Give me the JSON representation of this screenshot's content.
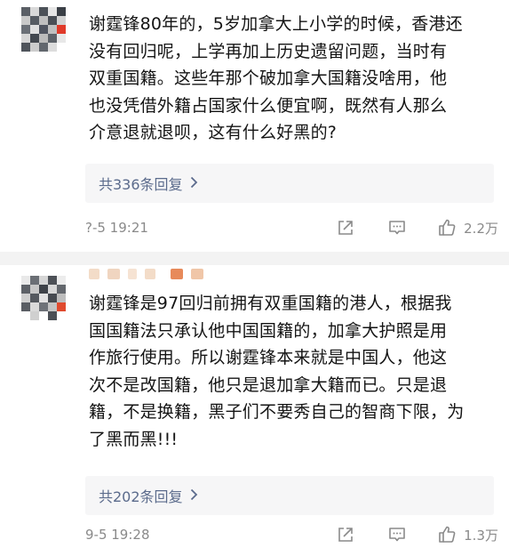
{
  "comments": [
    {
      "text": "谢霆锋80年的，5岁加拿大上小学的时候，香港还\n没有回归呢，上学再加上历史遗留问题，当时有\n双重国籍。这些年那个破加拿大国籍没啥用，他\n也没凭借外籍占国家什么便宜啊，既然有人那么\n介意退就退呗，这有什么好黑的?",
      "replies": "共336条回复",
      "time": "?-5 19:21",
      "likes": "2.2万"
    },
    {
      "text": "谢霆锋是97回归前拥有双重国籍的港人，根据我\n国国籍法只承认他中国国籍的，加拿大护照是用\n作旅行使用。所以谢霆锋本来就是中国人，他这\n次不是改国籍，他只是退加拿大籍而已。只是退\n籍，不是换籍，黑子们不要秀自己的智商下限，为\n了黑而黑!!!",
      "replies": "共202条回复",
      "time": "9-5 19:28",
      "likes": "1.3万"
    }
  ],
  "icons": {
    "reply_chevron": "chevron-right-icon",
    "share": "share-icon",
    "comment": "comment-icon",
    "like": "thumbs-up-icon"
  },
  "colors": {
    "reply_link": "#5b6b8c",
    "meta_text": "#8a8a8a",
    "reply_box_bg": "#f6f6f7"
  }
}
